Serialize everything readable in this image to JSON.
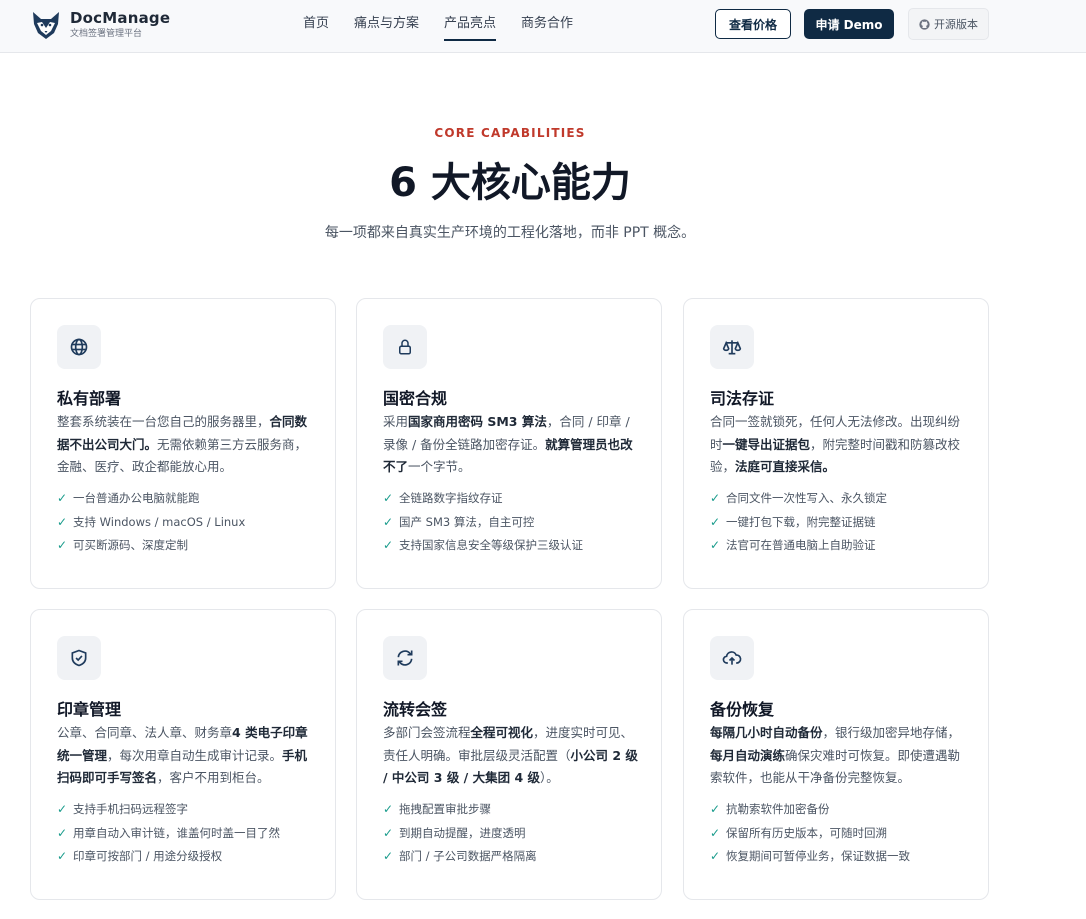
{
  "brand": {
    "name": "DocManage",
    "tagline": "文档签署管理平台"
  },
  "nav": [
    {
      "label": "首页",
      "active": false
    },
    {
      "label": "痛点与方案",
      "active": false
    },
    {
      "label": "产品亮点",
      "active": true
    },
    {
      "label": "商务合作",
      "active": false
    }
  ],
  "actions": {
    "pricing": "查看价格",
    "demo": "申请 Demo",
    "open_source": "开源版本"
  },
  "section": {
    "eyebrow": "CORE CAPABILITIES",
    "title": "6 大核心能力",
    "subtitle": "每一项都来自真实生产环境的工程化落地，而非 PPT 概念。"
  },
  "cards": [
    {
      "icon": "globe-icon",
      "title": "私有部署",
      "desc": [
        {
          "t": "整套系统装在一台您自己的服务器里，",
          "b": false
        },
        {
          "t": "合同数据不出公司大门。",
          "b": true
        },
        {
          "t": "无需依赖第三方云服务商，金融、医疗、政企都能放心用。",
          "b": false
        }
      ],
      "features": [
        "一台普通办公电脑就能跑",
        "支持 Windows / macOS / Linux",
        "可买断源码、深度定制"
      ]
    },
    {
      "icon": "lock-icon",
      "title": "国密合规",
      "desc": [
        {
          "t": "采用",
          "b": false
        },
        {
          "t": "国家商用密码 SM3 算法",
          "b": true
        },
        {
          "t": "，合同 / 印章 / 录像 / 备份全链路加密存证。",
          "b": false
        },
        {
          "t": "就算管理员也改不了",
          "b": true
        },
        {
          "t": "一个字节。",
          "b": false
        }
      ],
      "features": [
        "全链路数字指纹存证",
        "国产 SM3 算法，自主可控",
        "支持国家信息安全等级保护三级认证"
      ]
    },
    {
      "icon": "scale-icon",
      "title": "司法存证",
      "desc": [
        {
          "t": "合同一签就锁死，任何人无法修改。出现纠纷时",
          "b": false
        },
        {
          "t": "一键导出证据包",
          "b": true
        },
        {
          "t": "，附完整时间戳和防篡改校验，",
          "b": false
        },
        {
          "t": "法庭可直接采信。",
          "b": true
        }
      ],
      "features": [
        "合同文件一次性写入、永久锁定",
        "一键打包下载，附完整证据链",
        "法官可在普通电脑上自助验证"
      ]
    },
    {
      "icon": "shield-check-icon",
      "title": "印章管理",
      "desc": [
        {
          "t": "公章、合同章、法人章、财务章",
          "b": false
        },
        {
          "t": "4 类电子印章统一管理",
          "b": true
        },
        {
          "t": "，每次用章自动生成审计记录。",
          "b": false
        },
        {
          "t": "手机扫码即可手写签名",
          "b": true
        },
        {
          "t": "，客户不用到柜台。",
          "b": false
        }
      ],
      "features": [
        "支持手机扫码远程签字",
        "用章自动入审计链，谁盖何时盖一目了然",
        "印章可按部门 / 用途分级授权"
      ]
    },
    {
      "icon": "refresh-icon",
      "title": "流转会签",
      "desc": [
        {
          "t": "多部门会签流程",
          "b": false
        },
        {
          "t": "全程可视化",
          "b": true
        },
        {
          "t": "，进度实时可见、责任人明确。审批层级灵活配置（",
          "b": false
        },
        {
          "t": "小公司 2 级 / 中公司 3 级 / 大集团 4 级",
          "b": true
        },
        {
          "t": "）。",
          "b": false
        }
      ],
      "features": [
        "拖拽配置审批步骤",
        "到期自动提醒，进度透明",
        "部门 / 子公司数据严格隔离"
      ]
    },
    {
      "icon": "cloud-upload-icon",
      "title": "备份恢复",
      "desc": [
        {
          "t": "每隔几小时自动备份",
          "b": true
        },
        {
          "t": "，银行级加密异地存储，",
          "b": false
        },
        {
          "t": "每月自动演练",
          "b": true
        },
        {
          "t": "确保灾难时可恢复。即使遭遇勒索软件，也能从干净备份完整恢复。",
          "b": false
        }
      ],
      "features": [
        "抗勒索软件加密备份",
        "保留所有历史版本，可随时回溯",
        "恢复期间可暂停业务，保证数据一致"
      ]
    }
  ],
  "colors": {
    "primary": "#0f2a44",
    "accent": "#c0392b",
    "check": "#1a9c8c"
  }
}
